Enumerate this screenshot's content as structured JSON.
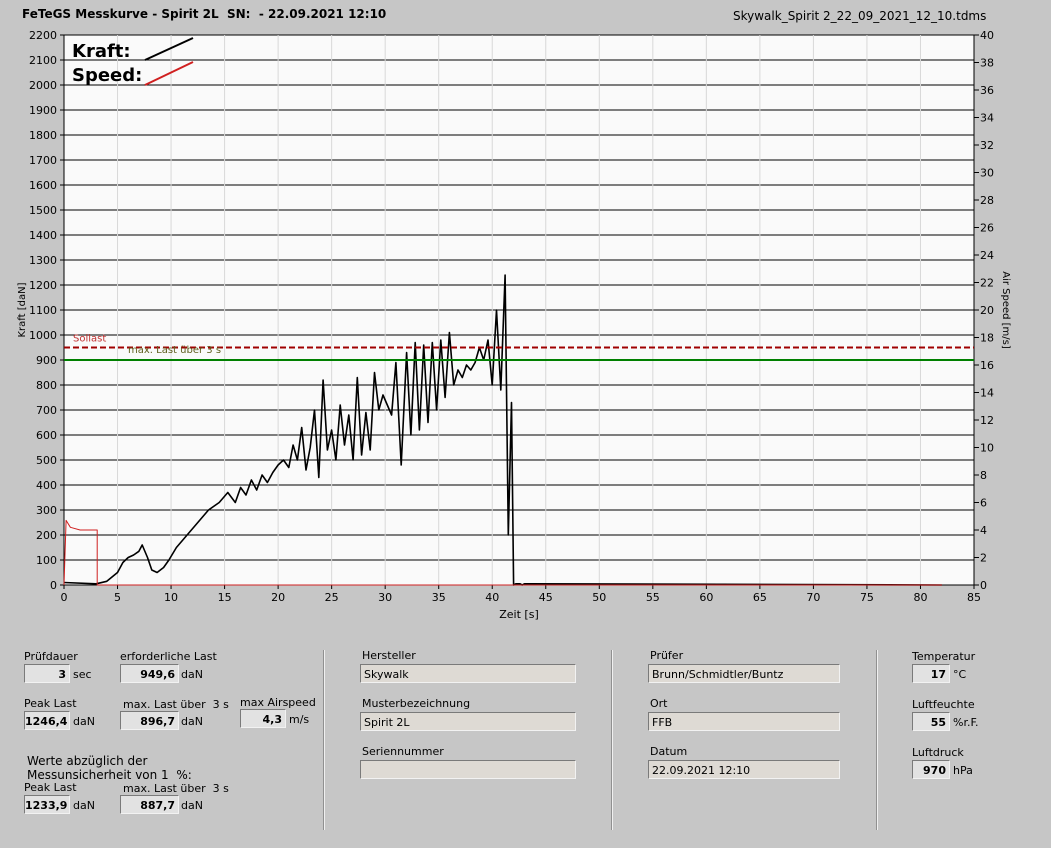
{
  "header": {
    "title": "FeTeGS Messkurve - Spirit 2L  SN:  - 22.09.2021 12:10",
    "filename": "Skywalk_Spirit 2_22_09_2021_12_10.tdms"
  },
  "legend": {
    "kraft": "Kraft:",
    "speed": "Speed:"
  },
  "annotations": {
    "sollast": "Sollast",
    "maxlast": "max. Last über  3 s"
  },
  "colors": {
    "kraft": "#000000",
    "speed": "#d02020",
    "sollast": "#a00000",
    "maxlast": "#008000",
    "plot_bg": "#fafafa"
  },
  "chart_data": {
    "type": "line",
    "title": "",
    "xlabel": "Zeit [s]",
    "ylabel": "Kraft [daN]",
    "y2label": "Air Speed [m/s]",
    "xlim": [
      0,
      85
    ],
    "ylim": [
      0,
      2200
    ],
    "y2lim": [
      0,
      40
    ],
    "x_ticks": [
      "0",
      "5",
      "10",
      "15",
      "20",
      "25",
      "30",
      "35",
      "40",
      "45",
      "50",
      "55",
      "60",
      "65",
      "70",
      "75",
      "80",
      "85"
    ],
    "y_ticks": [
      "0",
      "100",
      "200",
      "300",
      "400",
      "500",
      "600",
      "700",
      "800",
      "900",
      "1000",
      "1100",
      "1200",
      "1300",
      "1400",
      "1500",
      "1600",
      "1700",
      "1800",
      "1900",
      "2000",
      "2100",
      "2200"
    ],
    "y2_ticks": [
      "0",
      "2",
      "4",
      "6",
      "8",
      "10",
      "12",
      "14",
      "16",
      "18",
      "20",
      "22",
      "24",
      "26",
      "28",
      "30",
      "32",
      "34",
      "36",
      "38",
      "40"
    ],
    "grid": true,
    "reference_lines": [
      {
        "name": "Sollast",
        "y": 950,
        "style": "dashed"
      },
      {
        "name": "max. Last über  3 s",
        "y": 900,
        "style": "solid"
      }
    ],
    "series": [
      {
        "name": "Kraft",
        "axis": "left",
        "x": [
          0,
          3,
          4,
          5,
          5.5,
          6,
          6.5,
          7,
          7.3,
          7.8,
          8.2,
          8.7,
          9.3,
          9.8,
          10.5,
          11.5,
          12.5,
          13.5,
          14.5,
          15.3,
          16,
          16.5,
          17,
          17.5,
          18,
          18.5,
          19,
          19.5,
          20,
          20.5,
          21,
          21.4,
          21.8,
          22.2,
          22.6,
          23,
          23.4,
          23.8,
          24.2,
          24.6,
          25,
          25.4,
          25.8,
          26.2,
          26.6,
          27,
          27.4,
          27.8,
          28.2,
          28.6,
          29,
          29.4,
          29.8,
          30.2,
          30.6,
          31,
          31.5,
          32,
          32.4,
          32.8,
          33.2,
          33.6,
          34,
          34.4,
          34.8,
          35.2,
          35.6,
          36,
          36.4,
          36.8,
          37.2,
          37.6,
          38,
          38.4,
          38.8,
          39.2,
          39.6,
          40,
          40.4,
          40.8,
          41.2,
          41.5,
          41.8,
          42,
          42.2,
          42.4,
          42.6,
          42.8,
          43,
          43.5,
          82
        ],
        "values": [
          10,
          5,
          15,
          50,
          90,
          110,
          120,
          135,
          160,
          110,
          60,
          50,
          70,
          100,
          150,
          200,
          250,
          300,
          330,
          370,
          330,
          390,
          360,
          420,
          380,
          440,
          410,
          450,
          480,
          500,
          470,
          560,
          500,
          630,
          460,
          550,
          700,
          430,
          820,
          540,
          620,
          500,
          720,
          560,
          680,
          500,
          830,
          520,
          690,
          540,
          850,
          700,
          760,
          720,
          680,
          890,
          480,
          930,
          600,
          970,
          620,
          960,
          650,
          970,
          700,
          980,
          750,
          1010,
          800,
          860,
          830,
          880,
          860,
          890,
          950,
          900,
          980,
          800,
          1100,
          780,
          1240,
          200,
          730,
          0,
          5,
          5,
          5,
          0,
          5,
          5,
          0
        ]
      },
      {
        "name": "Speed",
        "axis": "right",
        "x": [
          0,
          0.2,
          0.6,
          1.5,
          3.1,
          3.1,
          3.2,
          43,
          82
        ],
        "values": [
          0,
          4.7,
          4.2,
          4.0,
          4.0,
          0,
          0,
          0,
          0
        ]
      }
    ]
  },
  "panel": {
    "pruefdauer": {
      "label": "Prüfdauer",
      "value": "3",
      "unit": "sec"
    },
    "erforderliche_last": {
      "label": "erforderliche Last",
      "value": "949,6",
      "unit": "daN"
    },
    "peak_last": {
      "label": "Peak Last",
      "value": "1246,4",
      "unit": "daN"
    },
    "max_last": {
      "label": "max. Last über  3 s",
      "value": "896,7",
      "unit": "daN"
    },
    "max_airspeed": {
      "label": "max Airspeed",
      "value": "4,3",
      "unit": "m/s"
    },
    "note_line1": "Werte abzüglich der",
    "note_line2": "Messunsicherheit von 1  %:",
    "peak_last_corr": {
      "label": "Peak Last",
      "value": "1233,9",
      "unit": "daN"
    },
    "max_last_corr": {
      "label": "max. Last über  3 s",
      "value": "887,7",
      "unit": "daN"
    },
    "hersteller": {
      "label": "Hersteller",
      "value": "Skywalk"
    },
    "musterbezeichnung": {
      "label": "Musterbezeichnung",
      "value": "Spirit 2L"
    },
    "seriennummer": {
      "label": "Seriennummer",
      "value": ""
    },
    "pruefer": {
      "label": "Prüfer",
      "value": "Brunn/Schmidtler/Buntz"
    },
    "ort": {
      "label": "Ort",
      "value": "FFB"
    },
    "datum": {
      "label": "Datum",
      "value": "22.09.2021 12:10"
    },
    "temperatur": {
      "label": "Temperatur",
      "value": "17",
      "unit": "°C"
    },
    "luftfeuchte": {
      "label": "Luftfeuchte",
      "value": "55",
      "unit": "%r.F."
    },
    "luftdruck": {
      "label": "Luftdruck",
      "value": "970",
      "unit": "hPa"
    }
  }
}
